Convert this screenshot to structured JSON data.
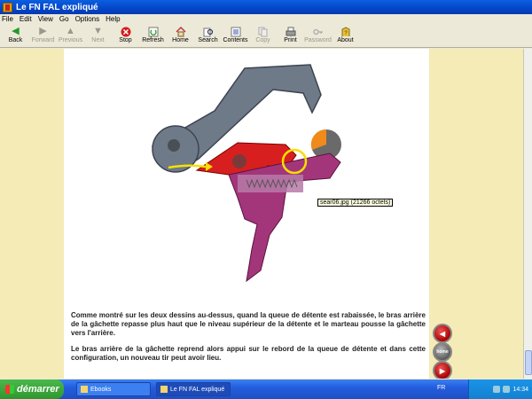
{
  "window": {
    "title": "Le FN FAL expliqué"
  },
  "menu": [
    "File",
    "Edit",
    "View",
    "Go",
    "Options",
    "Help"
  ],
  "toolbar": [
    {
      "label": "Back",
      "icon": "back-arrow-icon",
      "enabled": true
    },
    {
      "label": "Forward",
      "icon": "forward-arrow-icon",
      "enabled": false
    },
    {
      "label": "Previous",
      "icon": "up-arrow-icon",
      "enabled": false
    },
    {
      "label": "Next",
      "icon": "down-arrow-icon",
      "enabled": false
    },
    {
      "label": "Stop",
      "icon": "stop-icon",
      "enabled": true
    },
    {
      "label": "Refresh",
      "icon": "refresh-icon",
      "enabled": true
    },
    {
      "label": "Home",
      "icon": "home-icon",
      "enabled": true
    },
    {
      "label": "Search",
      "icon": "search-icon",
      "enabled": true
    },
    {
      "label": "Contents",
      "icon": "contents-icon",
      "enabled": true
    },
    {
      "label": "Copy",
      "icon": "copy-icon",
      "enabled": false
    },
    {
      "label": "Print",
      "icon": "print-icon",
      "enabled": true
    },
    {
      "label": "Password",
      "icon": "key-icon",
      "enabled": false
    },
    {
      "label": "About",
      "icon": "about-icon",
      "enabled": true
    }
  ],
  "content": {
    "tooltip": "sear06.jpg (21266 octets)",
    "paragraph1": "Comme montré sur les deux dessins au-dessus, quand la queue de détente est rabaissée, le bras arrière de la gâchette repasse plus haut que le niveau supérieur de la détente et le marteau pousse la gâchette vers l'arrière.",
    "paragraph2": "Le bras arrière de la gâchette reprend alors appui sur le rebord de la queue de détente et dans cette configuration, un nouveau tir peut avoir lieu.",
    "nav_home_label": "home"
  },
  "taskbar": {
    "start_label": "démarrer",
    "tasks": [
      {
        "label": "Ebooks",
        "active": false
      },
      {
        "label": "Le FN FAL expliqué",
        "active": true
      }
    ],
    "language": "FR",
    "clock": "14:34"
  }
}
